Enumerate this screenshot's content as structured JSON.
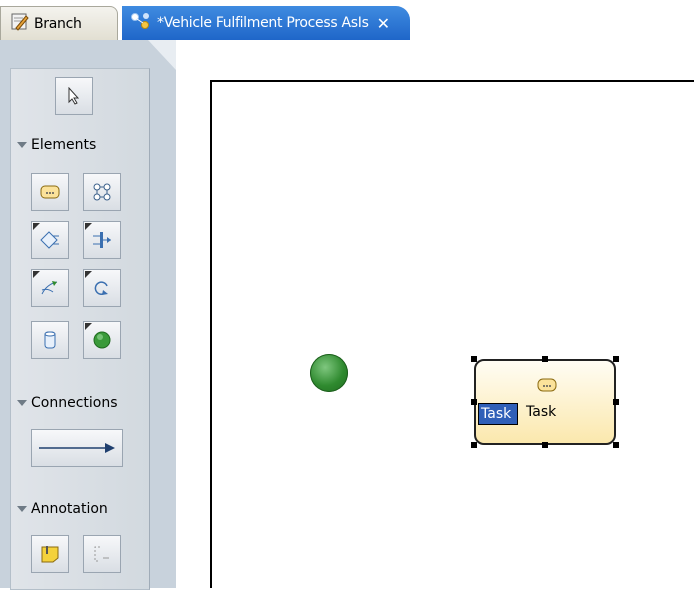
{
  "tabs": [
    {
      "label": "Branch",
      "icon": "pencil-icon"
    },
    {
      "label": "*Vehicle Fulfilment Process AsIs",
      "icon": "process-icon",
      "active": true
    }
  ],
  "palette": {
    "sections": [
      {
        "label": "Elements"
      },
      {
        "label": "Connections"
      },
      {
        "label": "Annotation"
      }
    ],
    "tools": [
      "select-tool-icon",
      "task-tool-icon",
      "subprocess-tool-icon",
      "decision-tool-icon",
      "fork-join-tool-icon",
      "flow-tool-icon",
      "loop-tool-icon",
      "datastore-tool-icon",
      "start-event-tool-icon",
      "connection-tool-icon",
      "note-tool-icon",
      "text-annotation-tool-icon"
    ]
  },
  "canvas": {
    "task": {
      "edit_value": "Task",
      "label": "Task"
    }
  },
  "colors": {
    "active_tab": "#2a6fd4",
    "task_fill": "#fbe8ad",
    "start_event": "#2f8a2f"
  }
}
